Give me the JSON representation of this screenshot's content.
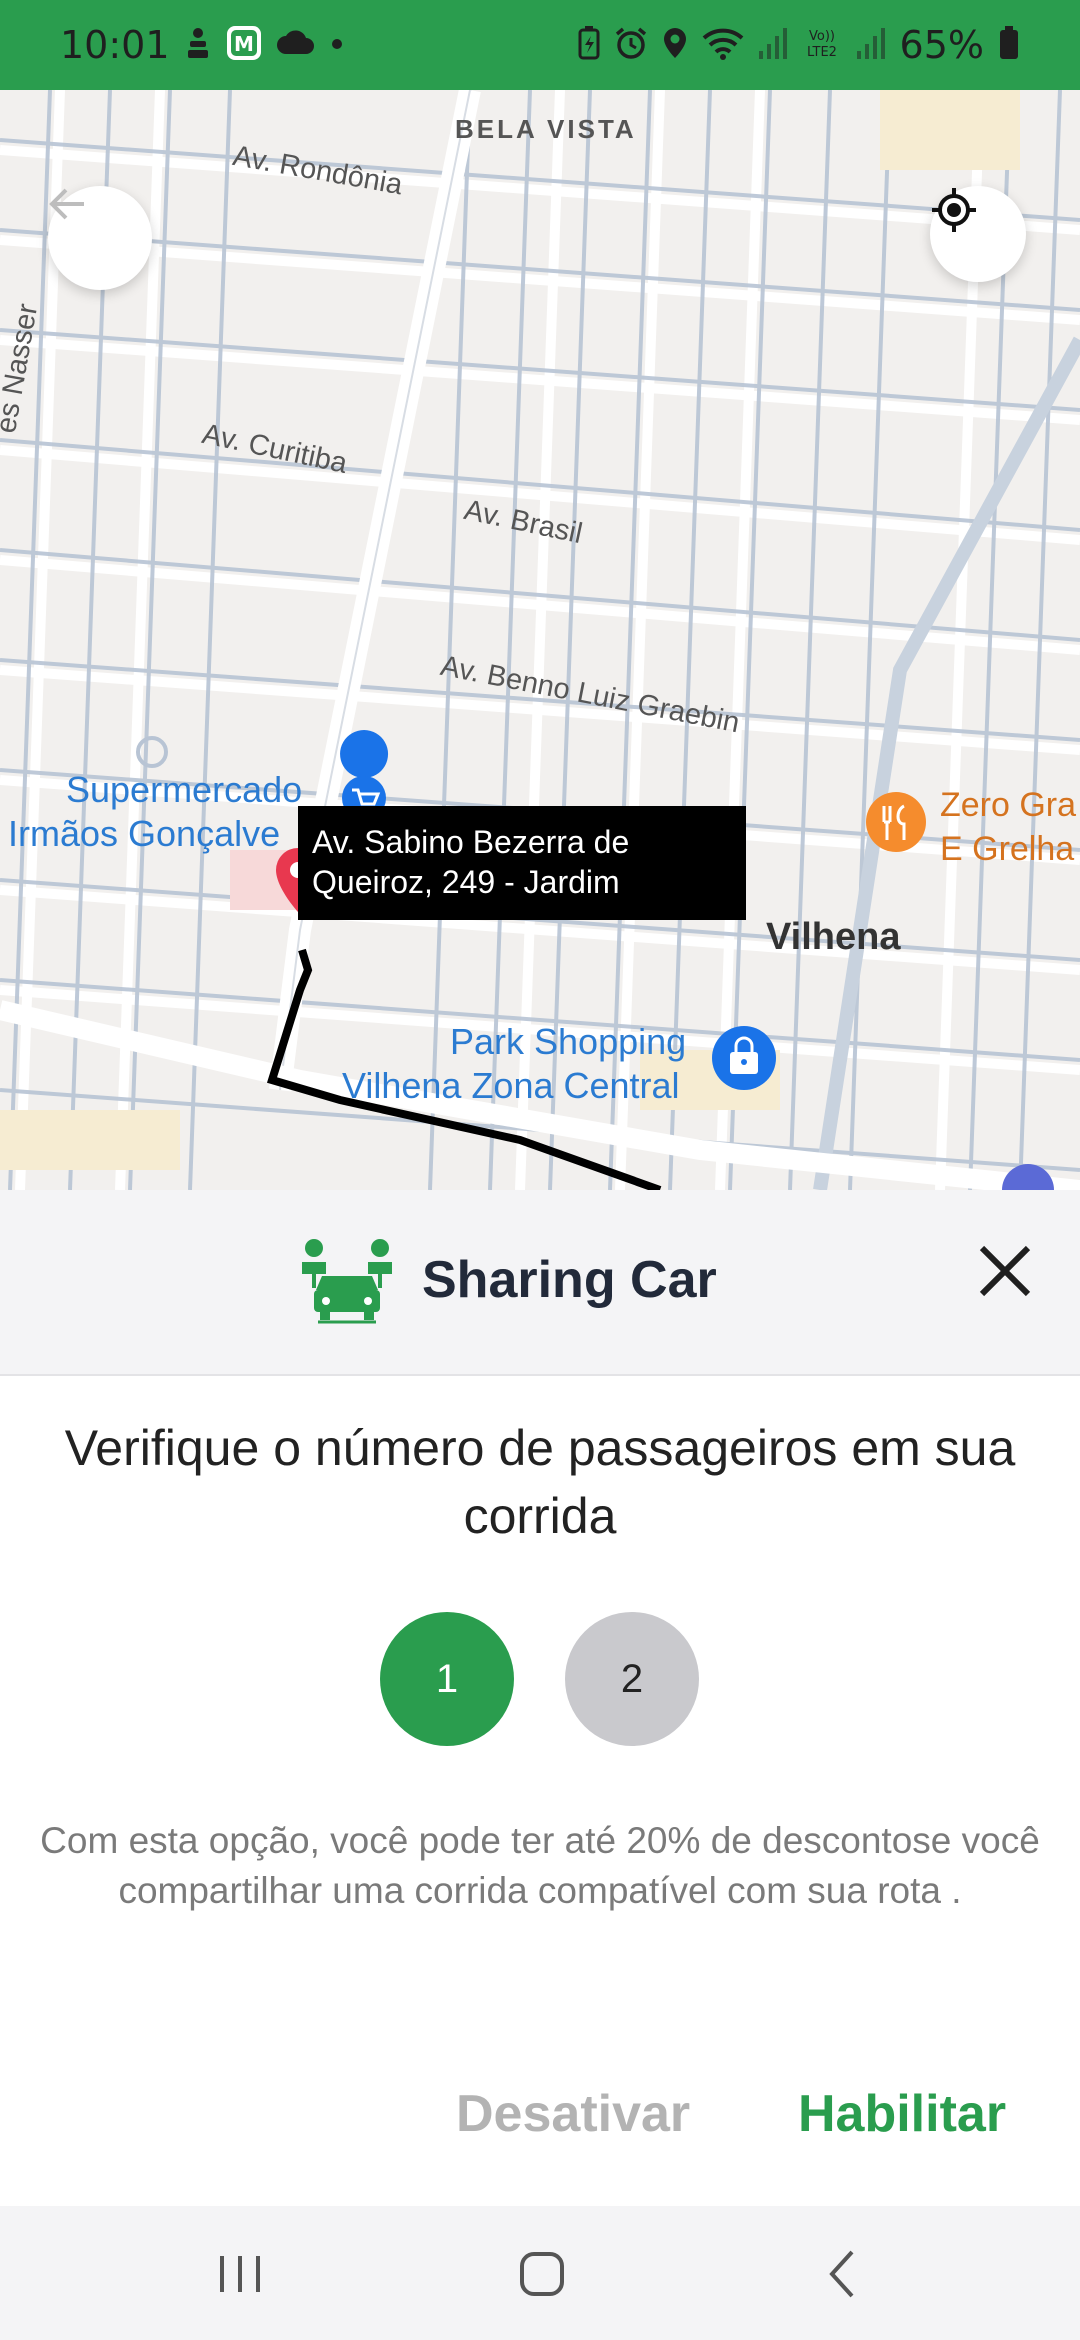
{
  "status_bar": {
    "time": "10:01",
    "battery_percent": "65%",
    "icons": [
      "cast-icon",
      "app-icon",
      "cloud-icon",
      "dot-icon",
      "battery-saver-icon",
      "alarm-icon",
      "location-icon",
      "wifi-icon",
      "signal-icon",
      "volte-icon",
      "signal-icon",
      "battery-icon"
    ]
  },
  "map": {
    "district": "BELA VISTA",
    "streets": [
      "Av. Rondônia",
      "Av. Curitiba",
      "Av. Brasil",
      "Av. Benno Luiz Graebin",
      "es Nasser"
    ],
    "pois": {
      "supermarket": [
        "Supermercado",
        "Irmãos Gonçalve"
      ],
      "mall": [
        "Park Shopping",
        "Vilhena Zona Central"
      ],
      "restaurant": [
        "Zero Gra",
        "E Grelha"
      ]
    },
    "city": "Vilhena",
    "address_tooltip": [
      "Av. Sabino Bezerra de",
      "Queiroz, 249 - Jardim"
    ],
    "back_icon": "arrow-left-icon",
    "locate_icon": "crosshair-icon"
  },
  "sheet": {
    "title": "Sharing Car",
    "title_icon": "sharing-car-icon",
    "close_icon": "close-icon",
    "question": "Verifique o número de passageiros em sua corrida",
    "passenger_options": [
      "1",
      "2"
    ],
    "selected_passengers": "1",
    "info": "Com esta opção, você pode ter até 20% de descontose você compartilhar uma corrida compatível com sua rota .",
    "disable_label": "Desativar",
    "enable_label": "Habilitar"
  },
  "colors": {
    "brand_green": "#2a9d4e",
    "pin_red": "#e8384f",
    "poi_blue": "#2b7bd1",
    "poi_orange": "#d5731f"
  },
  "nav_bar": {
    "icons": [
      "recent-apps-icon",
      "home-icon",
      "back-icon"
    ]
  }
}
